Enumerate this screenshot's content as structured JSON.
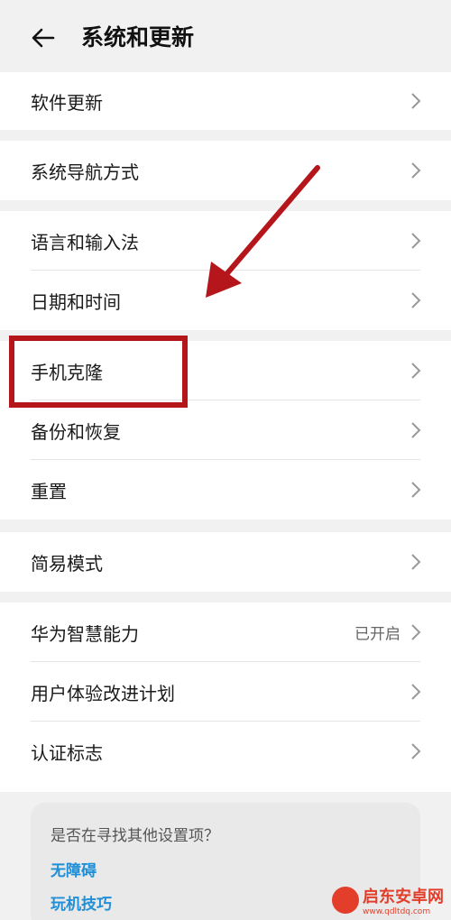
{
  "header": {
    "title": "系统和更新",
    "back_icon": "arrow-left-icon"
  },
  "groups": [
    {
      "items": [
        {
          "label": "软件更新"
        }
      ]
    },
    {
      "items": [
        {
          "label": "系统导航方式"
        }
      ]
    },
    {
      "items": [
        {
          "label": "语言和输入法"
        },
        {
          "label": "日期和时间"
        }
      ]
    },
    {
      "items": [
        {
          "label": "手机克隆"
        },
        {
          "label": "备份和恢复"
        },
        {
          "label": "重置"
        }
      ]
    },
    {
      "items": [
        {
          "label": "简易模式"
        }
      ]
    },
    {
      "items": [
        {
          "label": "华为智慧能力",
          "value": "已开启"
        },
        {
          "label": "用户体验改进计划"
        },
        {
          "label": "认证标志"
        }
      ]
    }
  ],
  "hint": {
    "question": "是否在寻找其他设置项？",
    "links": [
      "无障碍",
      "玩机技巧"
    ]
  },
  "annotation": {
    "color": "#b5161b"
  },
  "watermark": {
    "name": "启东安卓网",
    "url": "www.qdltdq.com"
  }
}
